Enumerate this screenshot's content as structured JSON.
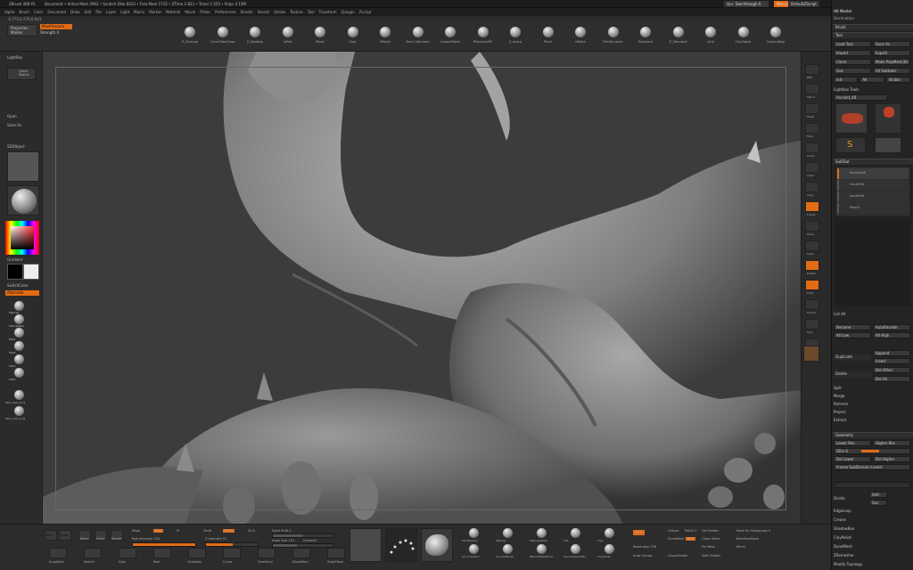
{
  "app": {
    "title": "ZBrush 4R8 P2",
    "title_info": "Document  • Active Mem 2962 • Scratch Disk 6023 • Free Mem 1715 • ZTime 1.823 • Timer 1.555 • Polys 0.15M",
    "quicksave": "QuickSave",
    "seethrough": "See-through 0",
    "menus_btn": "Menus",
    "defaultscript": "DefaultZScript"
  },
  "menubar": [
    "Alpha",
    "Brush",
    "Color",
    "Document",
    "Draw",
    "Edit",
    "File",
    "Layer",
    "Light",
    "Macro",
    "Marker",
    "Material",
    "Movie",
    "Picker",
    "Preferences",
    "Render",
    "Stencil",
    "Stroke",
    "Texture",
    "Tool",
    "Transform",
    "Zplugin",
    "Zscript"
  ],
  "coords": "-0.775,0.276,0.643",
  "topstrip": {
    "projection_master": "Projection Master",
    "lightbox": "LightBox",
    "mode_btn": "MaxPressure",
    "strength": "Strength 0",
    "brushes": [
      "Z_Cleanup",
      "CurveTubeSnap",
      "Z_Doubles",
      "Inflat",
      "Move",
      "Clay",
      "hPolish",
      "Dam_Standard",
      "sLowerPolish",
      "PlanarizeMP",
      "Z_sharp",
      "Pinch",
      "sPolish",
      "TrimDynamic",
      "Standard",
      "Z_Standard",
      "sCut",
      "ClayTubes",
      "Claybuildup"
    ]
  },
  "left": {
    "lightbox": "LightBox",
    "quick_sketch": "Quick Sketch",
    "open": "Open",
    "save_as": "Save As",
    "sdiobject": "SDIObject",
    "gradient": "Gradient",
    "switch_color": "SwitchColor",
    "alternate": "Alternate",
    "materials": [
      "MatCap",
      "MatCapRed",
      "Mat1",
      "Mat2",
      "Mat3",
      "Mat4"
    ],
    "bottom_mats": [
      "Skin_Sub_0_01",
      "Skin_Sub_0_02"
    ]
  },
  "right_shelf": [
    "BPR",
    "SPix 3",
    "Persp",
    "Floor",
    "Local",
    "LSym",
    "Gxyz",
    "Frame",
    "Move",
    "Scale",
    "Rotate",
    "PolyF",
    "Transp",
    "Solo",
    "Xpose"
  ],
  "rpanel": {
    "header": "Hit Master",
    "subheader": "Decimation",
    "brush": "Brush",
    "tool": "Tool",
    "tool_rows": [
      [
        "Load Tool",
        "Save As"
      ],
      [
        "Import",
        "Export"
      ],
      [
        "Clone",
        "Make PolyMesh3D"
      ],
      [
        "Goz",
        "All Subtools"
      ],
      [
        "Init",
        "All",
        "Visible"
      ]
    ],
    "lightbox_tools": "Lightbox Tools",
    "current_tool": "Ancient_48",
    "tool_thumbs": [
      "Ancient_48",
      "Cylinder3D",
      "PolyMesh3D",
      "SimpleBrush",
      "SimpleStar"
    ],
    "subtool": "SubTool",
    "subtool_items": [
      "Ancient48",
      "mouth06",
      "mouth08",
      "Mouth"
    ],
    "list_all": "List All",
    "rename": "Rename",
    "autoreorder": "AutoReorder",
    "all_low": "All Low",
    "all_high": "All High",
    "duplicate": "Duplicate",
    "append": "Append",
    "insert": "Insert",
    "del_other": "Del Other",
    "delete": "Delete",
    "del_all": "Del All",
    "split": "Split",
    "merge": "Merge",
    "remesh": "Remesh",
    "project": "Project",
    "extract": "Extract",
    "geometry": "Geometry",
    "lower_res": "Lower Res",
    "higher_res": "Higher Res",
    "sdiv": "SDiv 6",
    "del_lower": "Del Lower",
    "del_higher": "Del Higher",
    "freeze": "Freeze SubDivision Levels",
    "divide": "Divide",
    "smt": "Smt",
    "suv": "Suv",
    "tail": [
      "EdgeLoop",
      "Crease",
      "ShadowBox",
      "ClayPolish",
      "DynaMesh",
      "ZRemesher",
      "Modify Topology"
    ]
  },
  "bottom": {
    "edit": "Edit",
    "draw": "Draw",
    "move": "Move",
    "scale": "Scale",
    "rotate": "Rotate",
    "mrgb": "Mrgb",
    "rgb": "Rgb",
    "m": "M",
    "zadd": "Zadd",
    "zsub": "Zsub",
    "zcut": "Zcut",
    "rgb_intensity": "Rgb Intensity 100",
    "z_intensity": "Z Intensity 51",
    "focal_shift": "Focal Shift 0",
    "draw_size": "Draw Size 101",
    "dynamic": "Dynamic",
    "btn_row": [
      "SnapShot",
      "Sketch",
      "Dots",
      "Rect",
      "Snakehk",
      "Curve",
      "FreeHand",
      "ZoomRect",
      "SubsPlane"
    ],
    "mat_buttons": [
      "SkinShade4",
      "MatCap",
      "MatCapWhite",
      "Flat",
      "Clay",
      "Quick Sketch",
      "SmoothBrush",
      "ZBrushMatsBrush",
      "GeneralScaleMix",
      "ClayPolish"
    ],
    "polymask": "PolyF",
    "groups": "Groups",
    "polish": "Polish 0",
    "del_hidden": "Del Hidden",
    "mask_by_polygroups": "Mask By Polygroups 0",
    "bpr": "BPR",
    "dynamesh": "DynaMesh",
    "close_holes": "Close Holes",
    "backface": "BackfaceMask",
    "resolution": "Resolution 256",
    "fix_mesh": "Fix Mesh",
    "mirror": "Mirror",
    "auto_groups": "Auto Groups",
    "group_visible": "GroupVisible",
    "split_hidden": "Split Hidden"
  },
  "colors": {
    "accent": "#e26c14",
    "bg": "#2b2b2b",
    "viewport": "#3c3c3c"
  }
}
